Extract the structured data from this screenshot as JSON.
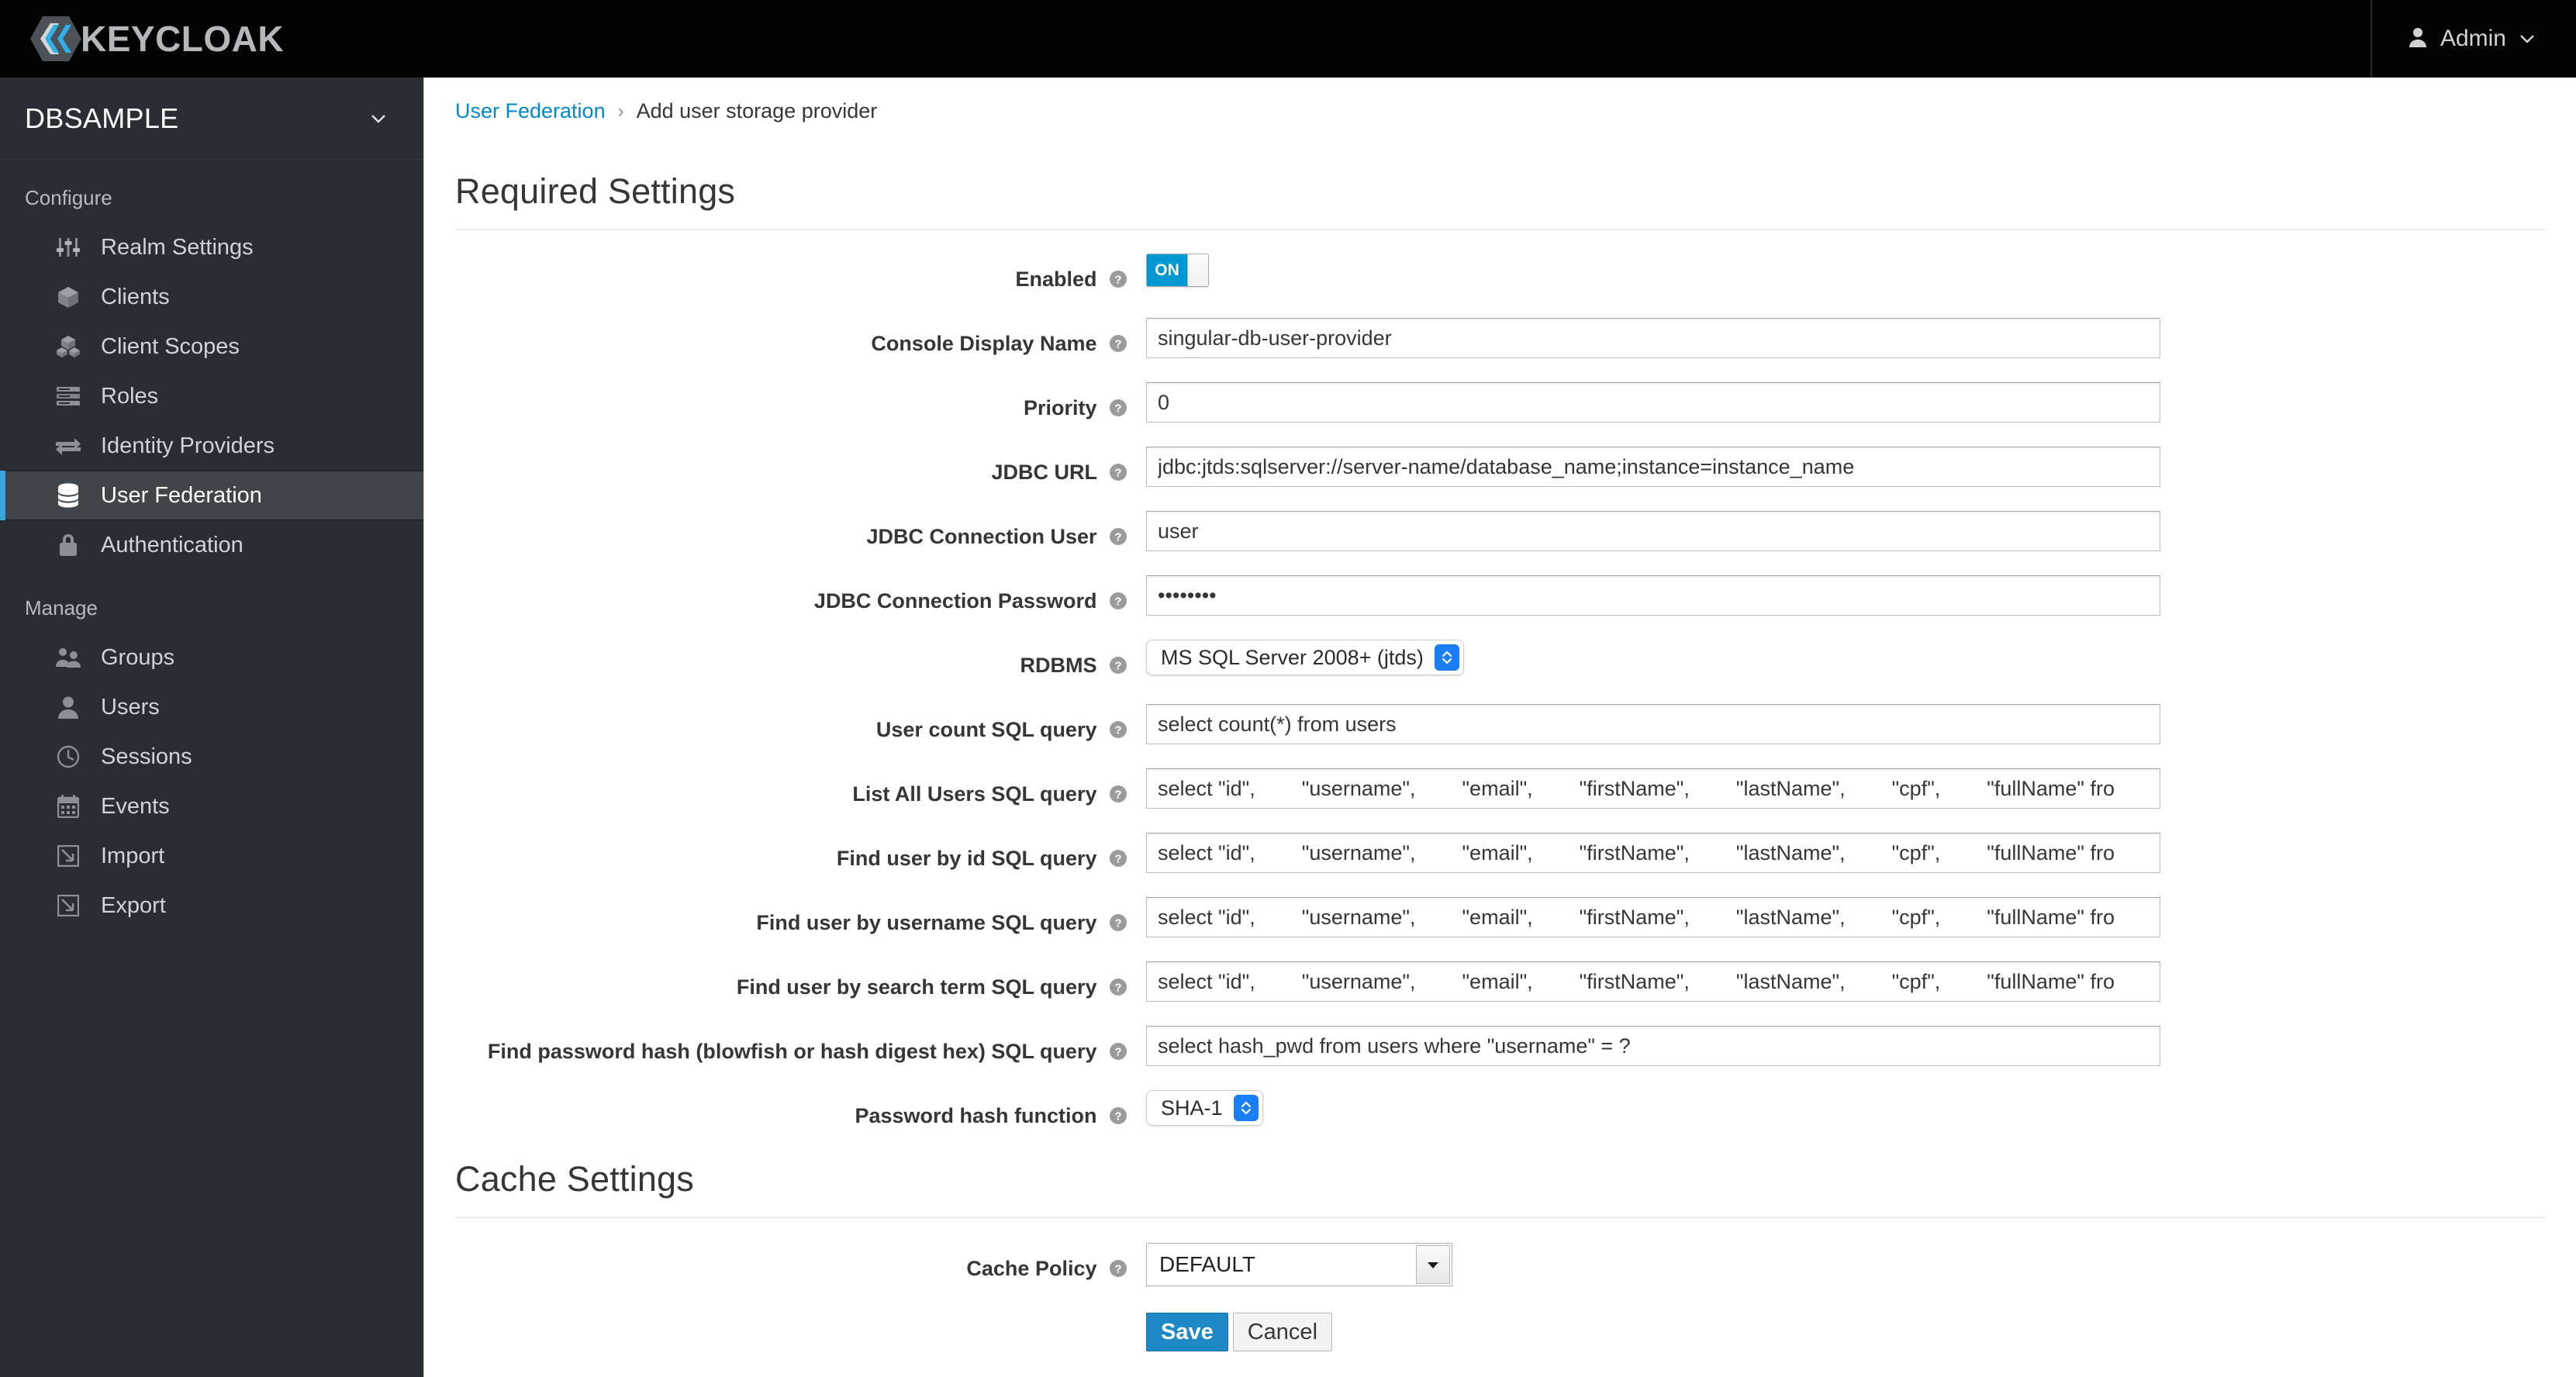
{
  "topbar": {
    "brand_name": "KEYCLOAK",
    "brand_icon": "keycloak-logo",
    "user_label": "Admin",
    "user_icon": "user-avatar-icon",
    "user_chevron_icon": "chevron-down-icon"
  },
  "sidebar": {
    "realm_name": "DBSAMPLE",
    "realm_chevron_icon": "chevron-down-icon",
    "groups": [
      {
        "title": "Configure",
        "items": [
          {
            "label": "Realm Settings",
            "icon": "sliders-icon",
            "active": false
          },
          {
            "label": "Clients",
            "icon": "cube-icon",
            "active": false
          },
          {
            "label": "Client Scopes",
            "icon": "cubes-icon",
            "active": false
          },
          {
            "label": "Roles",
            "icon": "list-bars-icon",
            "active": false
          },
          {
            "label": "Identity Providers",
            "icon": "exchange-arrows-icon",
            "active": false
          },
          {
            "label": "User Federation",
            "icon": "database-icon",
            "active": true
          },
          {
            "label": "Authentication",
            "icon": "lock-icon",
            "active": false
          }
        ]
      },
      {
        "title": "Manage",
        "items": [
          {
            "label": "Groups",
            "icon": "users-group-icon",
            "active": false
          },
          {
            "label": "Users",
            "icon": "user-icon",
            "active": false
          },
          {
            "label": "Sessions",
            "icon": "clock-icon",
            "active": false
          },
          {
            "label": "Events",
            "icon": "calendar-icon",
            "active": false
          },
          {
            "label": "Import",
            "icon": "import-arrow-icon",
            "active": false
          },
          {
            "label": "Export",
            "icon": "export-arrow-icon",
            "active": false
          }
        ]
      }
    ]
  },
  "breadcrumb": {
    "parent": "User Federation",
    "separator": "›",
    "current": "Add user storage provider"
  },
  "required_settings": {
    "heading": "Required Settings",
    "enabled": {
      "label": "Enabled",
      "help_icon": "help-circle-icon",
      "toggle_on_text": "ON",
      "value": "ON"
    },
    "console_display_name": {
      "label": "Console Display Name",
      "help_icon": "help-circle-icon",
      "value": "singular-db-user-provider"
    },
    "priority": {
      "label": "Priority",
      "help_icon": "help-circle-icon",
      "value": "0"
    },
    "jdbc_url": {
      "label": "JDBC URL",
      "help_icon": "help-circle-icon",
      "value": "jdbc:jtds:sqlserver://server-name/database_name;instance=instance_name"
    },
    "jdbc_connection_user": {
      "label": "JDBC Connection User",
      "help_icon": "help-circle-icon",
      "value": "user"
    },
    "jdbc_connection_password": {
      "label": "JDBC Connection Password",
      "help_icon": "help-circle-icon",
      "value": "••••••••"
    },
    "rdbms": {
      "label": "RDBMS",
      "help_icon": "help-circle-icon",
      "value": "MS SQL Server 2008+ (jtds)"
    },
    "user_count_sql_query": {
      "label": "User count SQL query",
      "help_icon": "help-circle-icon",
      "value": "select count(*) from users"
    },
    "list_all_users_sql_query": {
      "label": "List All Users SQL query",
      "help_icon": "help-circle-icon",
      "value": "select \"id\",        \"username\",        \"email\",        \"firstName\",        \"lastName\",        \"cpf\",        \"fullName\" fro"
    },
    "find_user_by_id_sql_query": {
      "label": "Find user by id SQL query",
      "help_icon": "help-circle-icon",
      "value": "select \"id\",        \"username\",        \"email\",        \"firstName\",        \"lastName\",        \"cpf\",        \"fullName\" fro"
    },
    "find_user_by_username_sql_query": {
      "label": "Find user by username SQL query",
      "help_icon": "help-circle-icon",
      "value": "select \"id\",        \"username\",        \"email\",        \"firstName\",        \"lastName\",        \"cpf\",        \"fullName\" fro"
    },
    "find_user_by_search_term_sql_query": {
      "label": "Find user by search term SQL query",
      "help_icon": "help-circle-icon",
      "value": "select \"id\",        \"username\",        \"email\",        \"firstName\",        \"lastName\",        \"cpf\",        \"fullName\" fro"
    },
    "find_password_hash_sql_query": {
      "label": "Find password hash (blowfish or hash digest hex) SQL query",
      "help_icon": "help-circle-icon",
      "value": "select hash_pwd from users where \"username\" = ?"
    },
    "password_hash_function": {
      "label": "Password hash function",
      "help_icon": "help-circle-icon",
      "value": "SHA-1"
    }
  },
  "cache_settings": {
    "heading": "Cache Settings",
    "cache_policy": {
      "label": "Cache Policy",
      "help_icon": "help-circle-icon",
      "value": "DEFAULT"
    }
  },
  "actions": {
    "save_label": "Save",
    "cancel_label": "Cancel"
  },
  "colors": {
    "accent_blue": "#0088ce",
    "toggle_on": "#0098d3",
    "sidebar_bg": "#292e34",
    "topbar_bg": "#030303",
    "active_item_bg": "#3f4549",
    "active_marker": "#39a5dc",
    "save_button": "#1d88c5"
  }
}
